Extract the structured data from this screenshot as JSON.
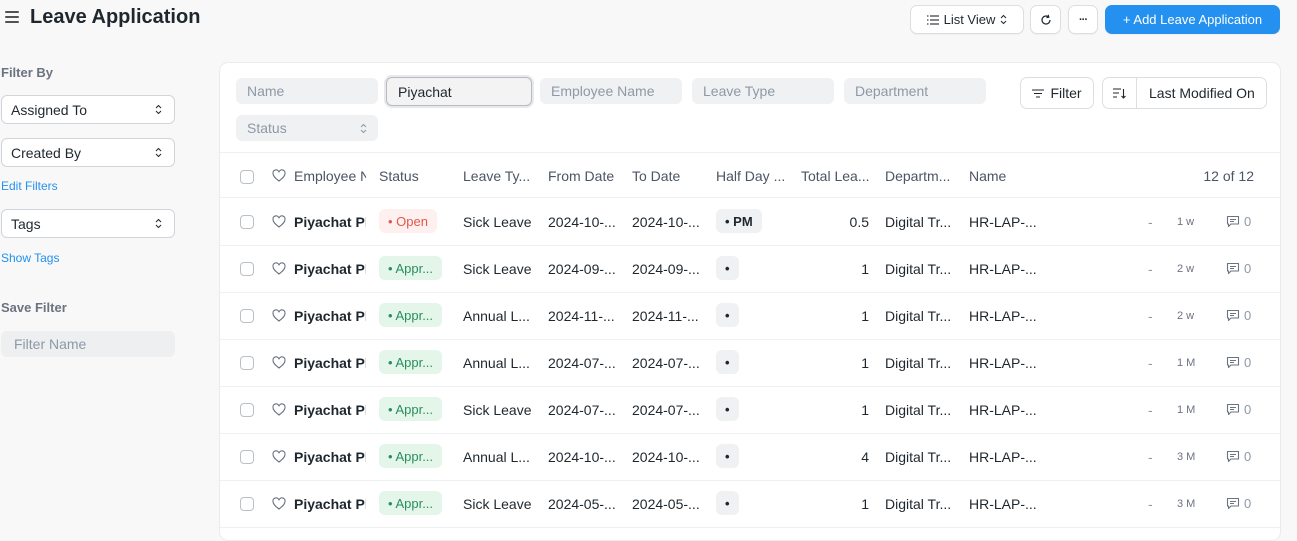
{
  "header": {
    "title": "Leave Application",
    "list_view_label": "List View",
    "add_button_label": "+ Add Leave Application",
    "more_label": "···"
  },
  "sidebar": {
    "filter_by_label": "Filter By",
    "assigned_to": "Assigned To",
    "created_by": "Created By",
    "edit_filters": "Edit Filters",
    "tags": "Tags",
    "show_tags": "Show Tags",
    "save_filter_label": "Save Filter",
    "filter_name_placeholder": "Filter Name"
  },
  "filters": {
    "name_placeholder": "Name",
    "employee_value": "Piyachat",
    "employee_name_placeholder": "Employee Name",
    "leave_type_placeholder": "Leave Type",
    "department_placeholder": "Department",
    "status_placeholder": "Status",
    "filter_button": "Filter",
    "sort_label": "Last Modified On"
  },
  "table": {
    "columns": {
      "employee": "Employee N",
      "status": "Status",
      "leave_type": "Leave Ty...",
      "from_date": "From Date",
      "to_date": "To Date",
      "half_day": "Half Day ...",
      "total_leave": "Total Lea...",
      "department": "Departm...",
      "name": "Name"
    },
    "count": "12 of 12",
    "rows": [
      {
        "employee": "Piyachat Pl",
        "status": "• Open",
        "status_type": "open",
        "leave_type": "Sick Leave",
        "from_date": "2024-10-...",
        "to_date": "2024-10-...",
        "half_day": "• PM",
        "total": "0.5",
        "department": "Digital Tr...",
        "name": "HR-LAP-...",
        "dash": "-",
        "time": "1 w",
        "comments": "0"
      },
      {
        "employee": "Piyachat Pl",
        "status": "• Appr...",
        "status_type": "approved",
        "leave_type": "Sick Leave",
        "from_date": "2024-09-...",
        "to_date": "2024-09-...",
        "half_day": "•",
        "total": "1",
        "department": "Digital Tr...",
        "name": "HR-LAP-...",
        "dash": "-",
        "time": "2 w",
        "comments": "0"
      },
      {
        "employee": "Piyachat Pl",
        "status": "• Appr...",
        "status_type": "approved",
        "leave_type": "Annual L...",
        "from_date": "2024-11-...",
        "to_date": "2024-11-...",
        "half_day": "•",
        "total": "1",
        "department": "Digital Tr...",
        "name": "HR-LAP-...",
        "dash": "-",
        "time": "2 w",
        "comments": "0"
      },
      {
        "employee": "Piyachat Pl",
        "status": "• Appr...",
        "status_type": "approved",
        "leave_type": "Annual L...",
        "from_date": "2024-07-...",
        "to_date": "2024-07-...",
        "half_day": "•",
        "total": "1",
        "department": "Digital Tr...",
        "name": "HR-LAP-...",
        "dash": "-",
        "time": "1 M",
        "comments": "0"
      },
      {
        "employee": "Piyachat Pl",
        "status": "• Appr...",
        "status_type": "approved",
        "leave_type": "Sick Leave",
        "from_date": "2024-07-...",
        "to_date": "2024-07-...",
        "half_day": "•",
        "total": "1",
        "department": "Digital Tr...",
        "name": "HR-LAP-...",
        "dash": "-",
        "time": "1 M",
        "comments": "0"
      },
      {
        "employee": "Piyachat Pl",
        "status": "• Appr...",
        "status_type": "approved",
        "leave_type": "Annual L...",
        "from_date": "2024-10-...",
        "to_date": "2024-10-...",
        "half_day": "•",
        "total": "4",
        "department": "Digital Tr...",
        "name": "HR-LAP-...",
        "dash": "-",
        "time": "3 M",
        "comments": "0"
      },
      {
        "employee": "Piyachat Pl",
        "status": "• Appr...",
        "status_type": "approved",
        "leave_type": "Sick Leave",
        "from_date": "2024-05-...",
        "to_date": "2024-05-...",
        "half_day": "•",
        "total": "1",
        "department": "Digital Tr...",
        "name": "HR-LAP-...",
        "dash": "-",
        "time": "3 M",
        "comments": "0"
      }
    ]
  },
  "colors": {
    "primary": "#2490ef",
    "open": "#e2574c",
    "approved": "#278f5e"
  }
}
